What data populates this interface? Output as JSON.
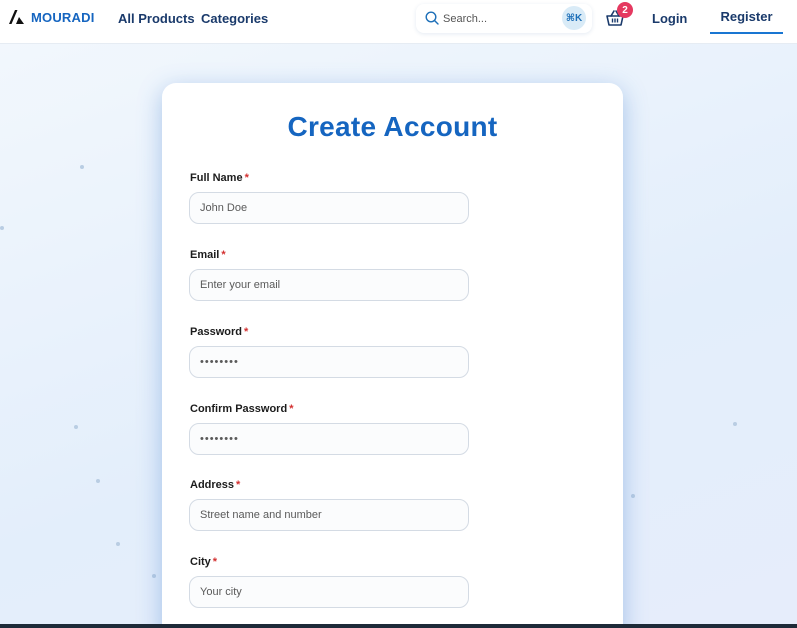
{
  "navbar": {
    "brand": "MOURADI",
    "links": {
      "all_products": "All Products",
      "categories": "Categories"
    },
    "search": {
      "placeholder": "Search...",
      "shortcut": "⌘K"
    },
    "cart": {
      "count": "2"
    },
    "login": "Login",
    "register": "Register"
  },
  "form": {
    "title": "Create Account",
    "required_marker": "*",
    "fields": [
      {
        "label": "Full Name",
        "placeholder": "John Doe",
        "value": ""
      },
      {
        "label": "Email",
        "placeholder": "Enter your email",
        "value": ""
      },
      {
        "label": "Password",
        "placeholder": "••••••••",
        "value": ""
      },
      {
        "label": "Confirm Password",
        "placeholder": "••••••••",
        "value": ""
      },
      {
        "label": "Address",
        "placeholder": "Street name and number",
        "value": ""
      },
      {
        "label": "City",
        "placeholder": "Your city",
        "value": ""
      }
    ]
  },
  "colors": {
    "brand": "#1565c0",
    "badge": "#e53960",
    "required": "#d32f2f",
    "active_underline": "#1976d2"
  }
}
